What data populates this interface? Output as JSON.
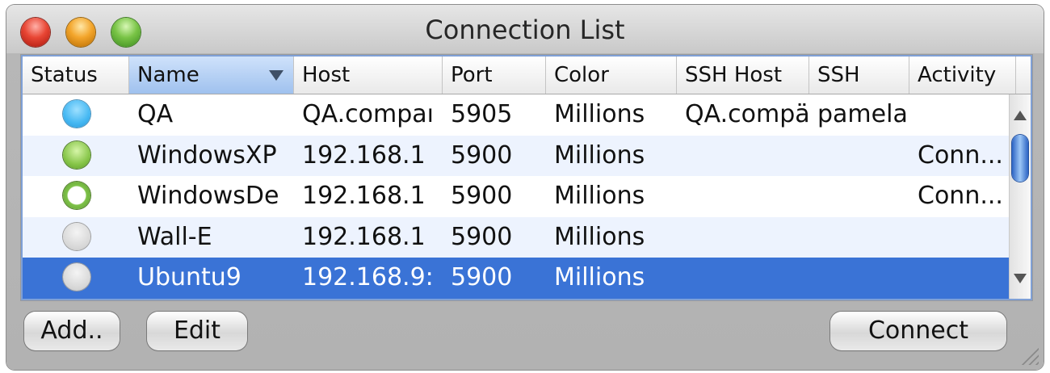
{
  "window": {
    "title": "Connection List"
  },
  "columns": [
    "Status",
    "Name",
    "Host",
    "Port",
    "Color",
    "SSH Host",
    "SSH",
    "Activity"
  ],
  "rows": [
    {
      "status": "blue",
      "name": "QA",
      "host": "QA.compaı",
      "port": "5905",
      "color": "Millions",
      "ssh_host": "QA.compä",
      "ssh": "pamela",
      "activity": ""
    },
    {
      "status": "green",
      "name": "WindowsXP",
      "host": "192.168.1",
      "port": "5900",
      "color": "Millions",
      "ssh_host": "",
      "ssh": "",
      "activity": "Conn..."
    },
    {
      "status": "green-ring",
      "name": "WindowsDe",
      "host": "192.168.1",
      "port": "5900",
      "color": "Millions",
      "ssh_host": "",
      "ssh": "",
      "activity": "Conn..."
    },
    {
      "status": "gray",
      "name": "Wall-E",
      "host": "192.168.1",
      "port": "5900",
      "color": "Millions",
      "ssh_host": "",
      "ssh": "",
      "activity": ""
    },
    {
      "status": "gray",
      "name": "Ubuntu9",
      "host": "192.168.9:",
      "port": "5900",
      "color": "Millions",
      "ssh_host": "",
      "ssh": "",
      "activity": "",
      "selected": true
    }
  ],
  "buttons": {
    "add": "Add..",
    "edit": "Edit",
    "connect": "Connect"
  },
  "colors": {
    "selection": "#3a73d6",
    "alt_row": "#edf3fe"
  },
  "icons": {
    "status_blue": "status-blue-dot-icon",
    "status_green": "status-green-dot-icon",
    "status_gray": "status-gray-dot-icon"
  }
}
